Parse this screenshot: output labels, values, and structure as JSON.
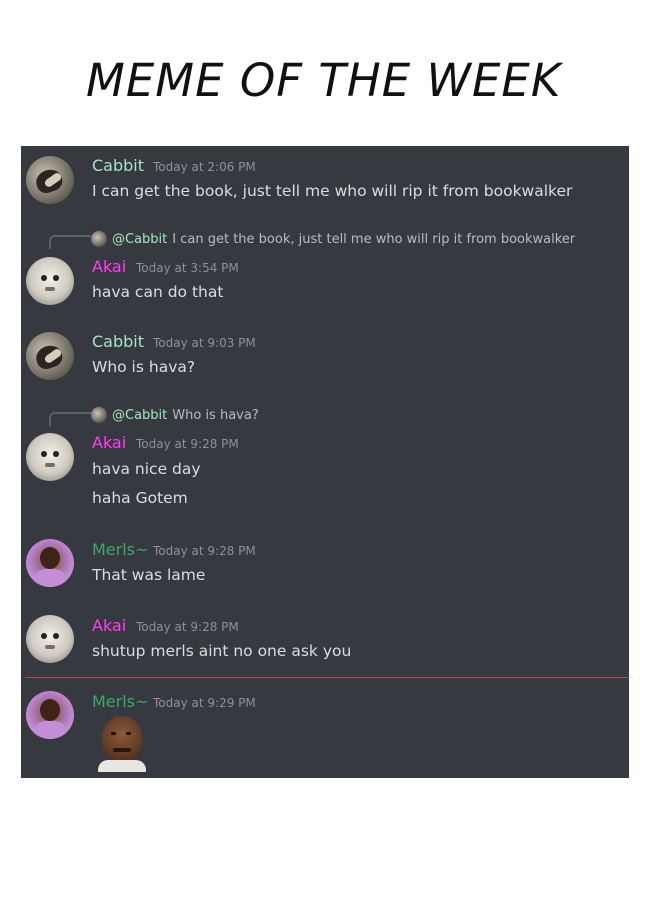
{
  "page": {
    "title": "MEME OF THE WEEK"
  },
  "messages": [
    {
      "author": "Cabbit",
      "timestamp": "Today at 2:06 PM",
      "lines": [
        "I can get the book, just tell me who will rip it from bookwalker"
      ]
    },
    {
      "reply_mention": "@Cabbit",
      "reply_text": "I can get the book, just tell me who will rip it from bookwalker",
      "author": "Akai",
      "timestamp": "Today at 3:54 PM",
      "lines": [
        "hava can do that"
      ]
    },
    {
      "author": "Cabbit",
      "timestamp": "Today at 9:03 PM",
      "lines": [
        "Who is hava?"
      ]
    },
    {
      "reply_mention": "@Cabbit",
      "reply_text": "Who is hava?",
      "author": "Akai",
      "timestamp": "Today at 9:28 PM",
      "lines": [
        "hava nice day",
        "haha Gotem"
      ]
    },
    {
      "author": "Merls~",
      "timestamp": "Today at 9:28 PM",
      "lines": [
        "That was lame"
      ]
    },
    {
      "author": "Akai",
      "timestamp": "Today at 9:28 PM",
      "lines": [
        "shutup merls aint no one ask you"
      ]
    },
    {
      "author": "Merls~",
      "timestamp": "Today at 9:29 PM",
      "lines": []
    }
  ],
  "colors": {
    "cabbit": "#a5e5c4",
    "akai": "#ff3df5",
    "merls": "#3fa86a",
    "background": "#36393f",
    "divider": "#c93c49"
  }
}
